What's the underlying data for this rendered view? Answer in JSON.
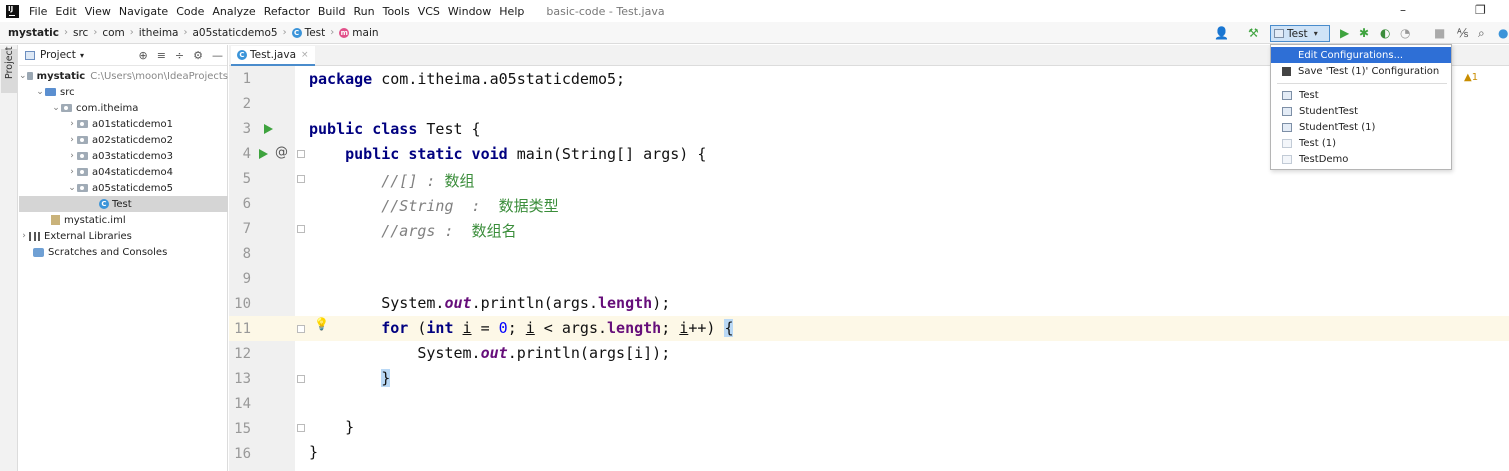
{
  "menubar": {
    "items": [
      "File",
      "Edit",
      "View",
      "Navigate",
      "Code",
      "Analyze",
      "Refactor",
      "Build",
      "Run",
      "Tools",
      "VCS",
      "Window",
      "Help"
    ],
    "title": "basic-code - Test.java"
  },
  "breadcrumb": {
    "project": "mystatic",
    "src": "src",
    "com": "com",
    "itheima": "itheima",
    "package": "a05staticdemo5",
    "class": "Test",
    "method": "main"
  },
  "run_config": {
    "label": "Test"
  },
  "project_panel": {
    "title": "Project",
    "tree": [
      {
        "label": "mystatic",
        "path": "C:\\Users\\moon\\IdeaProjects"
      },
      {
        "label": "src"
      },
      {
        "label": "com.itheima"
      },
      {
        "label": "a01staticdemo1"
      },
      {
        "label": "a02staticdemo2"
      },
      {
        "label": "a03staticdemo3"
      },
      {
        "label": "a04staticdemo4"
      },
      {
        "label": "a05staticdemo5"
      },
      {
        "label": "Test"
      },
      {
        "label": "mystatic.iml"
      },
      {
        "label": "External Libraries"
      },
      {
        "label": "Scratches and Consoles"
      }
    ],
    "stripe_label": "Project"
  },
  "editor": {
    "tab_label": "Test.java",
    "line_numbers": [
      "1",
      "2",
      "3",
      "4",
      "5",
      "6",
      "7",
      "8",
      "9",
      "10",
      "11",
      "12",
      "13",
      "14",
      "15",
      "16"
    ]
  },
  "dropdown": {
    "edit": "Edit Configurations...",
    "save": "Save 'Test (1)' Configuration",
    "configs": [
      "Test",
      "StudentTest",
      "StudentTest (1)",
      "Test (1)",
      "TestDemo"
    ]
  },
  "warning_count": "1",
  "colors": {
    "keyword": "#000080",
    "selection": "#2e6fd6",
    "highlight_line": "#fdf8e7"
  }
}
